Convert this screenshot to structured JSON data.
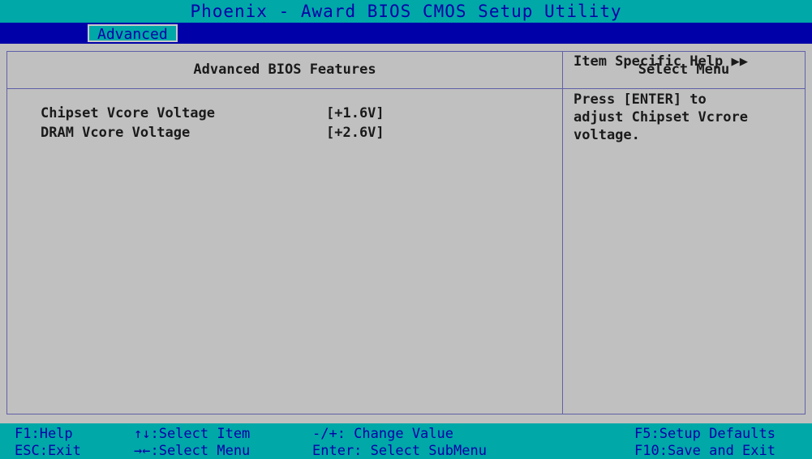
{
  "title": "Phoenix - Award BIOS CMOS Setup Utility",
  "menu_tab": "Advanced",
  "main_header": "Advanced BIOS Features",
  "side_header": "Select Menu",
  "settings": [
    {
      "label": "Chipset Vcore Voltage",
      "value": "[+1.6V]"
    },
    {
      "label": "DRAM Vcore Voltage",
      "value": "[+2.6V]"
    }
  ],
  "help": {
    "title": "Item Specific Help ▶▶",
    "text": "Press [ENTER] to\nadjust Chipset Vcrore\nvoltage."
  },
  "footer": {
    "row1": [
      "F1:Help",
      "↑↓:Select Item",
      "-/+: Change Value",
      "F5:Setup Defaults"
    ],
    "row2": [
      "ESC:Exit",
      "→←:Select Menu",
      "Enter: Select SubMenu",
      "F10:Save and Exit"
    ]
  },
  "colors": {
    "background": "#c0c0c0",
    "title_bar": "#00a8a8",
    "menu_bar": "#0000a8",
    "text_blue": "#0000a8"
  }
}
